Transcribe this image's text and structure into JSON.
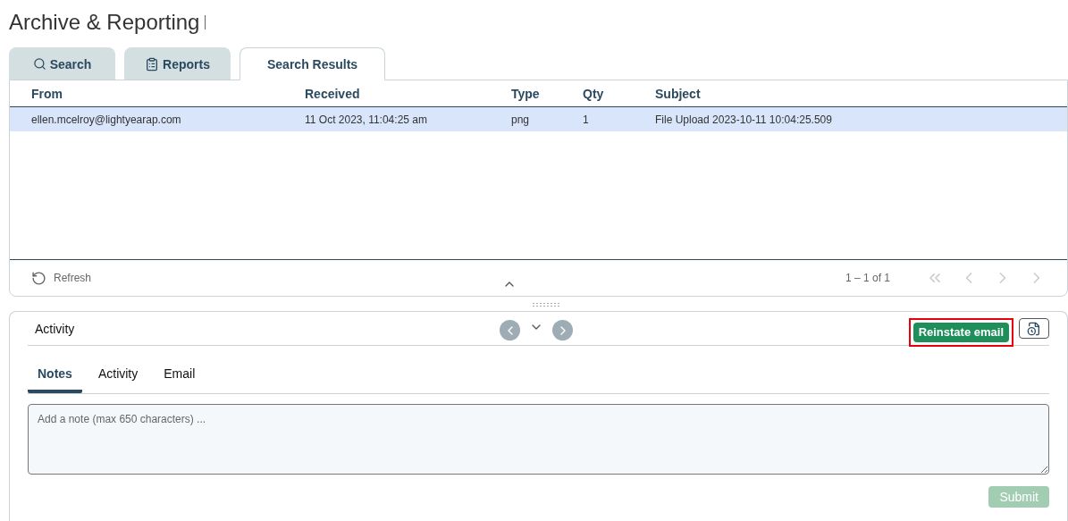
{
  "page": {
    "title": "Archive & Reporting"
  },
  "tabs": [
    {
      "label": "Search",
      "selected": false
    },
    {
      "label": "Reports",
      "selected": false
    },
    {
      "label": "Search Results",
      "selected": true
    }
  ],
  "table": {
    "columns": [
      "From",
      "Received",
      "Type",
      "Qty",
      "Subject"
    ],
    "rows": [
      {
        "cells": [
          "ellen.mcelroy@lightyearap.com",
          "11 Oct 2023, 11:04:25 am",
          "png",
          "1",
          "File Upload 2023-10-11 10:04:25.509"
        ],
        "selected": true
      }
    ]
  },
  "footer": {
    "refresh": "Refresh",
    "range": "1 – 1 of 1"
  },
  "detail": {
    "title": "Activity",
    "action": {
      "label": "Reinstate email",
      "highlighted": true
    },
    "tabs": [
      {
        "label": "Notes",
        "selected": true
      },
      {
        "label": "Activity",
        "selected": false
      },
      {
        "label": "Email",
        "selected": false
      }
    ],
    "note": {
      "placeholder": "Add a note (max 650 characters) ..."
    },
    "submit": {
      "label": "Submit",
      "disabled": true
    }
  }
}
